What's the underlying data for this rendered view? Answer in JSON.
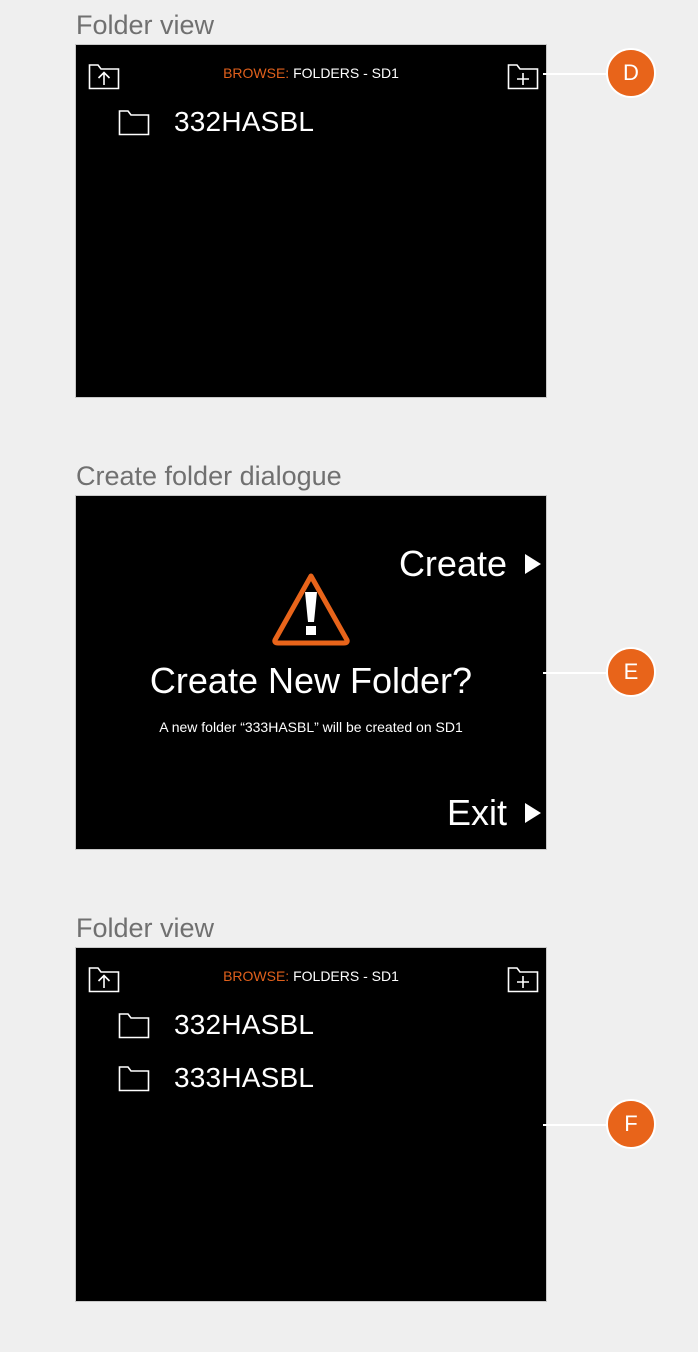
{
  "panels": {
    "top": {
      "section_title": "Folder view",
      "header_browse": "BROWSE:",
      "header_location": " FOLDERS - SD1",
      "folders": [
        "332HASBL"
      ],
      "callout": "D"
    },
    "dialog": {
      "section_title": "Create folder dialogue",
      "create_label": "Create",
      "heading": "Create New Folder?",
      "message": "A new folder “333HASBL” will be created on SD1",
      "exit_label": "Exit",
      "callout": "E"
    },
    "bottom": {
      "section_title": "Folder view",
      "header_browse": "BROWSE:",
      "header_location": " FOLDERS - SD1",
      "folders": [
        "332HASBL",
        "333HASBL"
      ],
      "callout": "F"
    }
  },
  "colors": {
    "accent": "#e8641a",
    "browse_label": "#e0601c",
    "screen_bg": "#000000",
    "page_bg": "#efefef"
  },
  "icons": {
    "up": "folder-up-icon",
    "new_folder": "new-folder-icon",
    "folder": "folder-icon",
    "warning": "warning-icon"
  }
}
